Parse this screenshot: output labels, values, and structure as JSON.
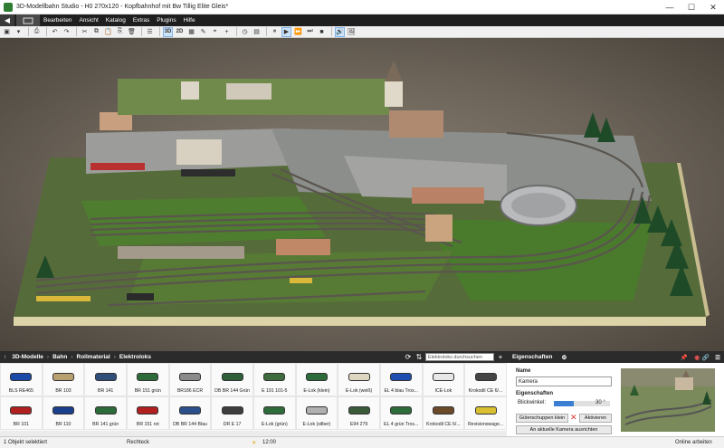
{
  "window": {
    "title": "3D-Modellbahn Studio - H0 270x120 - Kopfbahnhof mit Bw Tillig Elite Gleis*",
    "minimize": "—",
    "maximize": "☐",
    "close": "✕"
  },
  "menu": {
    "back": "◀",
    "items": [
      "Bearbeiten",
      "Ansicht",
      "Katalog",
      "Extras",
      "Plugins",
      "Hilfe"
    ]
  },
  "toolbar": {
    "view3d": "3D",
    "view2d": "2D"
  },
  "library": {
    "breadcrumb": [
      "3D-Modelle",
      "Bahn",
      "Rollmaterial",
      "Elektroloks"
    ],
    "search_placeholder": "Elektroloks durchsuchen",
    "items": [
      {
        "label": "BLS RE465",
        "color": "#1b4aa8"
      },
      {
        "label": "BR 103",
        "color": "#b8a070"
      },
      {
        "label": "BR 141",
        "color": "#2f4f7a"
      },
      {
        "label": "BR 151 grün",
        "color": "#2e6b3a"
      },
      {
        "label": "BR186 ECR",
        "color": "#8a8a8a"
      },
      {
        "label": "DB BR 144 Grün",
        "color": "#2e5e3a"
      },
      {
        "label": "E 191 101-5",
        "color": "#3d6b3d"
      },
      {
        "label": "E-Lok (klein)",
        "color": "#2e6b3a"
      },
      {
        "label": "E-Lok (weiß)",
        "color": "#ddd6c0"
      },
      {
        "label": "EL 4 blau Tros...",
        "color": "#1e4fb0"
      },
      {
        "label": "ICE-Lok",
        "color": "#e8e8e8"
      },
      {
        "label": "Krokodil CE 6/...",
        "color": "#444"
      },
      {
        "label": "BR 101",
        "color": "#b02020"
      },
      {
        "label": "BR 110",
        "color": "#1b3f8a"
      },
      {
        "label": "BR 141 grün",
        "color": "#2e6b3a"
      },
      {
        "label": "BR 151 rot",
        "color": "#b02020"
      },
      {
        "label": "DB BR 144 Blau",
        "color": "#2a4f8a"
      },
      {
        "label": "DR E 17",
        "color": "#3d3d3d"
      },
      {
        "label": "E-Lok (grün)",
        "color": "#2e6b3a"
      },
      {
        "label": "E-Lok (silber)",
        "color": "#b0b0b0"
      },
      {
        "label": "E94 279",
        "color": "#3a5a3a"
      },
      {
        "label": "EL 4 grün Tros...",
        "color": "#2e6b3a"
      },
      {
        "label": "Krokodil CE 6/...",
        "color": "#6b4a2a"
      },
      {
        "label": "Revisionswage...",
        "color": "#d8c030"
      }
    ]
  },
  "properties": {
    "title": "Eigenschaften",
    "name_label": "Name",
    "name_value": "Kamera",
    "section_label": "Eigenschaften",
    "angle_label": "Blickwinkel:",
    "angle_value": "30 °",
    "angle_fraction": 0.35,
    "lock_button": "Güterschuppen klein",
    "activate_button": "Aktivieren",
    "align_button": "An aktuelle Kamera ausrichten"
  },
  "status": {
    "selection": "1 Objekt selektiert",
    "mode": "Rechteck",
    "time": "12:00",
    "online": "Online arbeiten"
  }
}
